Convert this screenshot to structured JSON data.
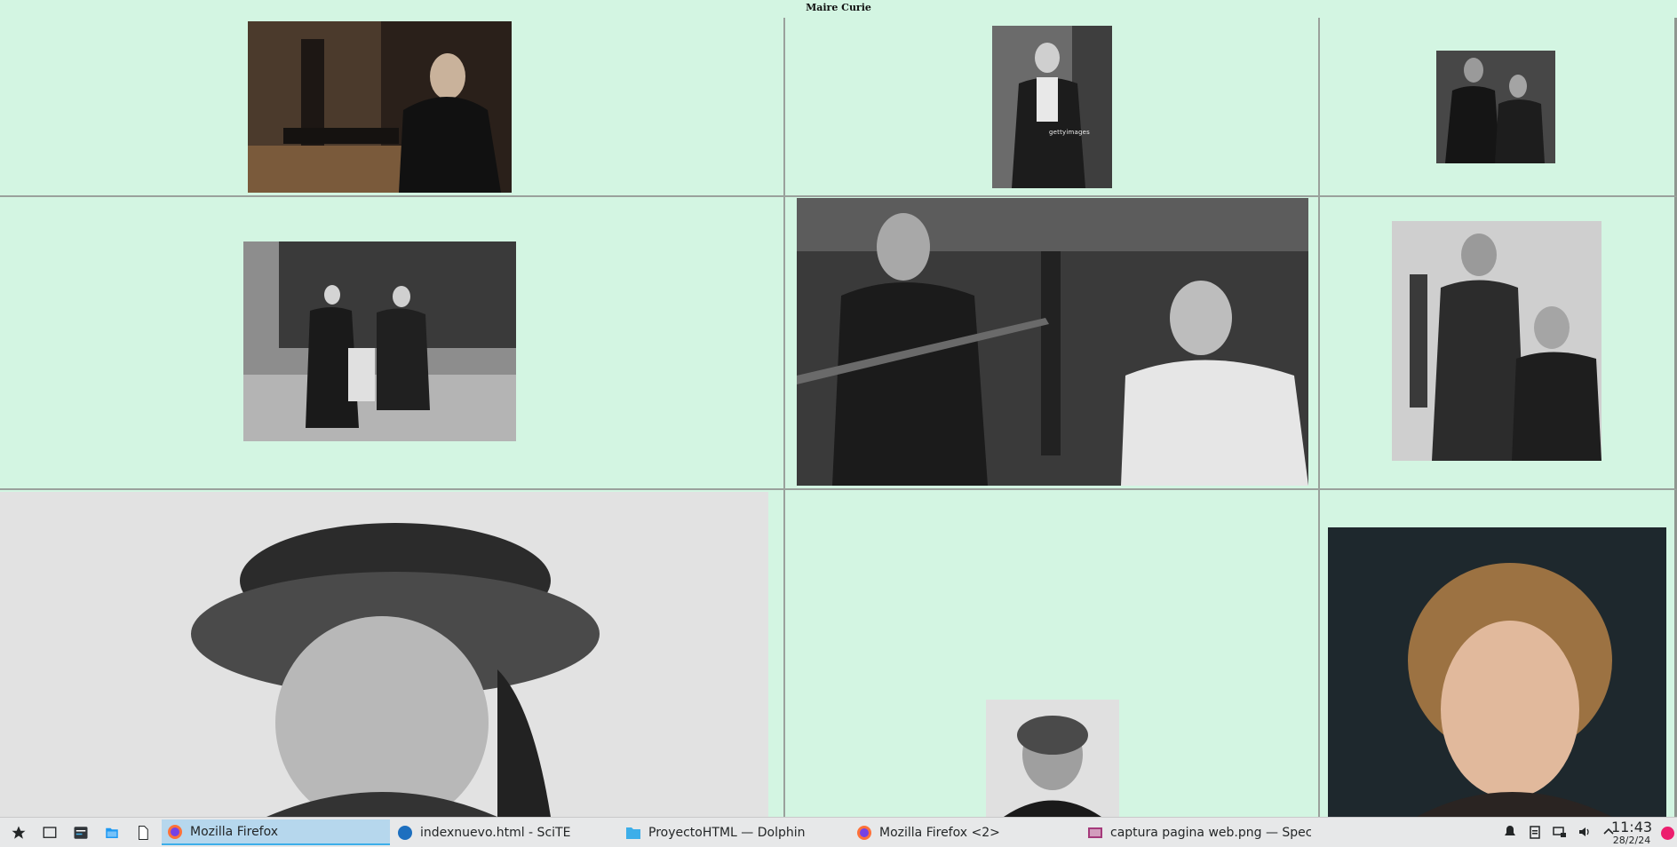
{
  "page": {
    "title": "Maire Curie"
  },
  "gallery": {
    "photos": [
      {
        "name": "curie-at-lab-desk-photo"
      },
      {
        "name": "curie-seated-portrait-photo",
        "watermark": "gettyimages"
      },
      {
        "name": "curie-with-daughter-photo"
      },
      {
        "name": "curie-family-garden-photo"
      },
      {
        "name": "pierre-and-marie-curie-lab-photo"
      },
      {
        "name": "curie-and-daughter-lab-photo"
      },
      {
        "name": "curie-in-hat-closeup-photo"
      },
      {
        "name": "curie-small-portrait-photo"
      },
      {
        "name": "actress-portrait-photo"
      }
    ]
  },
  "taskbar": {
    "launchers": [
      {
        "icon": "star-icon"
      },
      {
        "icon": "desktop-icon"
      },
      {
        "icon": "system-monitor-icon"
      },
      {
        "icon": "file-manager-icon"
      },
      {
        "icon": "new-document-icon"
      }
    ],
    "tasks": [
      {
        "label": "Mozilla Firefox",
        "icon": "firefox-icon",
        "active": true
      },
      {
        "label": "indexnuevo.html - SciTE",
        "icon": "scite-icon",
        "active": false
      },
      {
        "label": "ProyectoHTML — Dolphin",
        "icon": "folder-icon",
        "active": false
      },
      {
        "label": "Mozilla Firefox <2>",
        "icon": "firefox-icon",
        "active": false
      },
      {
        "label": "captura pagina web.png — Specta...",
        "icon": "spectacle-icon",
        "active": false
      }
    ],
    "clock": {
      "time": "11:43",
      "date": "28/2/24"
    },
    "tray_icons": [
      "notifications-icon",
      "clipboard-icon",
      "network-icon",
      "volume-icon",
      "expand-tray-icon"
    ],
    "colors": {
      "accent": "#3daee9",
      "record": "#ec1e6e"
    }
  }
}
